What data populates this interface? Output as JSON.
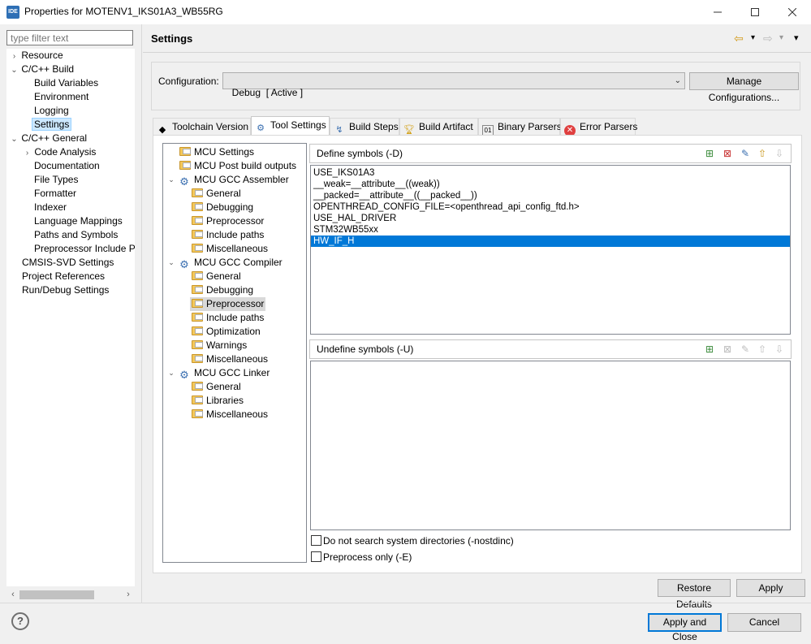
{
  "window": {
    "app_icon": "IDE",
    "title": "Properties for MOTENV1_IKS01A3_WB55RG",
    "minimize_icon": "minimize-icon",
    "maximize_icon": "maximize-icon",
    "close_icon": "close-icon"
  },
  "filter": {
    "placeholder": "type filter text"
  },
  "nav": {
    "items": [
      {
        "label": "Resource",
        "toggle": "›"
      },
      {
        "label": "C/C++ Build",
        "toggle": "⌄"
      },
      {
        "label": "Build Variables"
      },
      {
        "label": "Environment"
      },
      {
        "label": "Logging"
      },
      {
        "label": "Settings",
        "selected": true
      },
      {
        "label": "C/C++ General",
        "toggle": "⌄"
      },
      {
        "label": "Code Analysis",
        "toggle": "›"
      },
      {
        "label": "Documentation"
      },
      {
        "label": "File Types"
      },
      {
        "label": "Formatter"
      },
      {
        "label": "Indexer"
      },
      {
        "label": "Language Mappings"
      },
      {
        "label": "Paths and Symbols"
      },
      {
        "label": "Preprocessor Include Pat"
      },
      {
        "label": "CMSIS-SVD Settings"
      },
      {
        "label": "Project References"
      },
      {
        "label": "Run/Debug Settings"
      }
    ]
  },
  "header": {
    "title": "Settings",
    "back_icon": "⇦",
    "forward_icon": "⇨",
    "menu_icon": "▾"
  },
  "config": {
    "label": "Configuration:",
    "value": "Debug  [ Active ]",
    "manage_label": "Manage Configurations..."
  },
  "tabs": [
    {
      "label": "Toolchain  Version",
      "icon": "toolchain-icon"
    },
    {
      "label": "Tool Settings",
      "icon": "tool-settings-icon",
      "active": true
    },
    {
      "label": "Build Steps",
      "icon": "build-steps-icon"
    },
    {
      "label": "Build Artifact",
      "icon": "trophy-icon"
    },
    {
      "label": "Binary Parsers",
      "icon": "binary-icon"
    },
    {
      "label": "Error Parsers",
      "icon": "error-icon"
    }
  ],
  "tool_tree": [
    {
      "label": "MCU Settings",
      "type": "folder"
    },
    {
      "label": "MCU Post build outputs",
      "type": "folder"
    },
    {
      "label": "MCU GCC Assembler",
      "type": "tool",
      "toggle": "⌄"
    },
    {
      "label": "General",
      "type": "folder"
    },
    {
      "label": "Debugging",
      "type": "folder"
    },
    {
      "label": "Preprocessor",
      "type": "folder"
    },
    {
      "label": "Include paths",
      "type": "folder"
    },
    {
      "label": "Miscellaneous",
      "type": "folder"
    },
    {
      "label": "MCU GCC Compiler",
      "type": "tool",
      "toggle": "⌄"
    },
    {
      "label": "General",
      "type": "folder"
    },
    {
      "label": "Debugging",
      "type": "folder"
    },
    {
      "label": "Preprocessor",
      "type": "folder",
      "selected": true
    },
    {
      "label": "Include paths",
      "type": "folder"
    },
    {
      "label": "Optimization",
      "type": "folder"
    },
    {
      "label": "Warnings",
      "type": "folder"
    },
    {
      "label": "Miscellaneous",
      "type": "folder"
    },
    {
      "label": "MCU GCC Linker",
      "type": "tool",
      "toggle": "⌄"
    },
    {
      "label": "General",
      "type": "folder"
    },
    {
      "label": "Libraries",
      "type": "folder"
    },
    {
      "label": "Miscellaneous",
      "type": "folder"
    }
  ],
  "define": {
    "title": "Define symbols (-D)",
    "symbols": [
      "USE_IKS01A3",
      "__weak=__attribute__((weak))",
      "__packed=__attribute__((__packed__))",
      "OPENTHREAD_CONFIG_FILE=<openthread_api_config_ftd.h>",
      "USE_HAL_DRIVER",
      "STM32WB55xx",
      "HW_IF_H"
    ],
    "selected_index": 6
  },
  "undefine": {
    "title": "Undefine symbols (-U)",
    "symbols": []
  },
  "options": {
    "nostdinc_label": "Do not search system directories (-nostdinc)",
    "preprocess_only_label": "Preprocess only (-E)"
  },
  "buttons": {
    "restore_defaults": "Restore Defaults",
    "apply": "Apply",
    "apply_and_close": "Apply and Close",
    "cancel": "Cancel"
  },
  "help_icon": "?"
}
